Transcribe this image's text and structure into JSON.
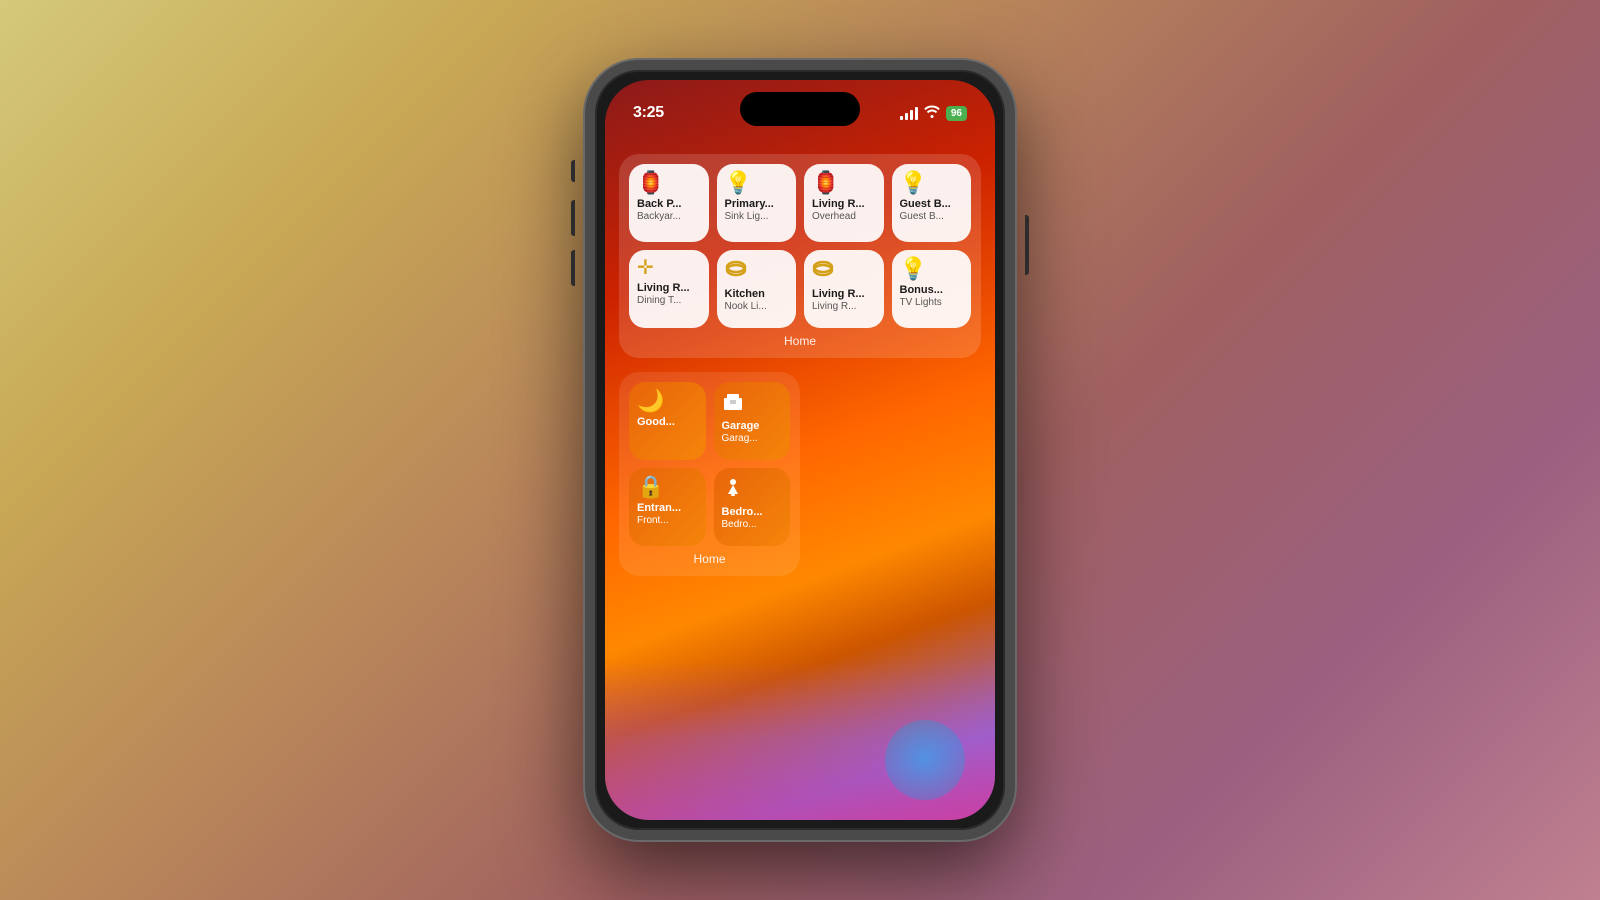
{
  "phone": {
    "status_bar": {
      "time": "3:25",
      "battery_level": "96",
      "battery_icon": "🔋"
    },
    "widget_group_1": {
      "label": "Home",
      "tiles": [
        {
          "id": "back-porch",
          "icon": "💡",
          "title": "Back P...",
          "subtitle": "Backyar..."
        },
        {
          "id": "primary-sink",
          "icon": "💡",
          "title": "Primary...",
          "subtitle": "Sink Lig..."
        },
        {
          "id": "living-overhead",
          "icon": "💡",
          "title": "Living R...",
          "subtitle": "Overhead"
        },
        {
          "id": "guest-bedroom",
          "icon": "💡",
          "title": "Guest B...",
          "subtitle": "Guest B..."
        },
        {
          "id": "living-dining",
          "icon": "✛",
          "title": "Living R...",
          "subtitle": "Dining T..."
        },
        {
          "id": "kitchen-nook",
          "icon": "🟡",
          "title": "Kitchen",
          "subtitle": "Nook Li..."
        },
        {
          "id": "living-room",
          "icon": "🟡",
          "title": "Living R...",
          "subtitle": "Living R..."
        },
        {
          "id": "bonus-tv",
          "icon": "💡",
          "title": "Bonus...",
          "subtitle": "TV Lights"
        }
      ]
    },
    "widget_group_2": {
      "label": "Home",
      "tiles": [
        {
          "id": "goodnight",
          "icon": "🌙",
          "title": "Good...",
          "subtitle": "",
          "style": "orange"
        },
        {
          "id": "garage",
          "icon": "🏠",
          "title": "Garage",
          "subtitle": "Garag...",
          "style": "orange"
        },
        {
          "id": "entrance",
          "icon": "🔒",
          "title": "Entran...",
          "subtitle": "Front...",
          "style": "orange"
        },
        {
          "id": "bedroom",
          "icon": "💡",
          "title": "Bedro...",
          "subtitle": "Bedro...",
          "style": "orange"
        }
      ]
    }
  }
}
